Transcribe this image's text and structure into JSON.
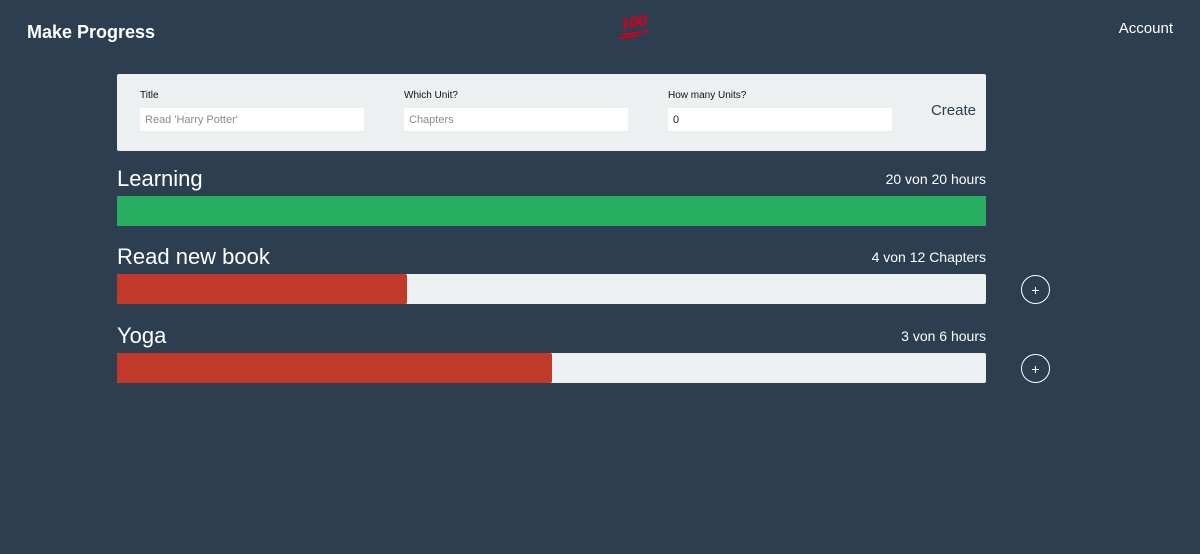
{
  "header": {
    "brand": "Make Progress",
    "logo_icon": "hundred-points-icon",
    "logo_glyph": "100",
    "account_label": "Account"
  },
  "form": {
    "title_label": "Title",
    "title_placeholder": "Read 'Harry Potter'",
    "unit_label": "Which Unit?",
    "unit_placeholder": "Chapters",
    "count_label": "How many Units?",
    "count_value": "0",
    "create_label": "Create"
  },
  "goals": [
    {
      "title": "Learning",
      "count_text": "20 von 20 hours",
      "done": 20,
      "total": 20,
      "complete": true
    },
    {
      "title": "Read new book",
      "count_text": "4 von 12 Chapters",
      "done": 4,
      "total": 12,
      "complete": false
    },
    {
      "title": "Yoga",
      "count_text": "3 von 6 hours",
      "done": 3,
      "total": 6,
      "complete": false
    }
  ],
  "plus_label": "+",
  "colors": {
    "background": "#2c3e50",
    "track": "#ecf0f1",
    "complete": "#27ae60",
    "in_progress": "#c0392b",
    "logo": "#d0021b"
  }
}
